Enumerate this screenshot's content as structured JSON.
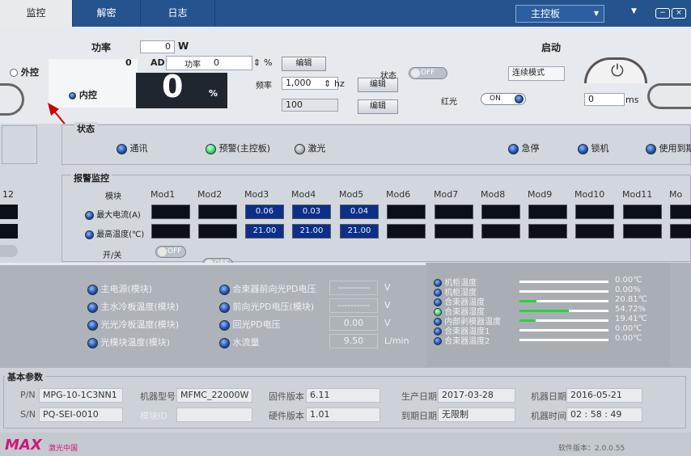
{
  "tabs": [
    "监控",
    "解密",
    "日志"
  ],
  "controller": "主控板",
  "top": {
    "power_label": "功率",
    "power_value": "0",
    "power_unit": "W",
    "start_label": "启动",
    "ext_label": "外控",
    "int_label": "内控",
    "ad_value": "0",
    "ad_label": "AD",
    "power2_label": "功率",
    "power2_value": "0",
    "pct": "%",
    "edit1": "编辑",
    "big_value": "0",
    "big_unit": "%",
    "freq_label": "频率",
    "freq_value": "1,000",
    "freq_unit": "hz",
    "edit2": "编辑",
    "duty_value": "100",
    "edit3": "编辑",
    "status_label": "状态",
    "off_label": "OFF",
    "red_label": "红光",
    "on_label": "ON",
    "mode_dd": "连续模式",
    "ms_value": "0",
    "ms_unit": "ms"
  },
  "status": {
    "title": "状态",
    "items": [
      "通讯",
      "预警(主控板)",
      "激光",
      "急停",
      "锁机",
      "使用到期"
    ]
  },
  "alarm": {
    "title": "报警监控",
    "col0": "模块",
    "left_edge": "12",
    "mods": [
      "Mod1",
      "Mod2",
      "Mod3",
      "Mod4",
      "Mod5",
      "Mod6",
      "Mod7",
      "Mod8",
      "Mod9",
      "Mod10",
      "Mod11",
      "Mo"
    ],
    "row1_label": "最大电流(A)",
    "row1": [
      "",
      "",
      "0.06",
      "0.03",
      "0.04",
      "",
      "",
      "",
      "",
      "",
      "",
      ""
    ],
    "row2_label": "最高温度(℃)",
    "row2": [
      "",
      "",
      "21.00",
      "21.00",
      "21.00",
      "",
      "",
      "",
      "",
      "",
      "",
      ""
    ],
    "row3_label": "开/关",
    "switches": [
      "OFF",
      "OFF",
      "ON",
      "ON",
      "ON",
      "OFF",
      "OFF",
      "OFF",
      "OFF",
      "OFF",
      "OFF",
      "OFF"
    ]
  },
  "sensors": {
    "left": [
      "主电源(模块)",
      "主水冷板温度(模块)",
      "光光冷板温度(模块)",
      "光模块温度(模块)"
    ],
    "mid": [
      {
        "label": "合束器前向光PD电压",
        "value": "----------",
        "unit": "V"
      },
      {
        "label": "前向光PD电压(模块)",
        "value": "----------",
        "unit": "V"
      },
      {
        "label": "回光PD电压",
        "value": "0.00",
        "unit": "V"
      },
      {
        "label": "水流量",
        "value": "9.50",
        "unit": "L/min"
      }
    ],
    "right": [
      {
        "label": "机柜温度",
        "value": "0.00℃",
        "fill": 0
      },
      {
        "label": "机柜湿度",
        "value": "0.00%",
        "fill": 0
      },
      {
        "label": "合束器温度",
        "value": "20.81℃",
        "fill": 0.19
      },
      {
        "label": "合束器湿度",
        "value": "54.72%",
        "fill": 0.55
      },
      {
        "label": "内部剥模器温度",
        "value": "19.41℃",
        "fill": 0.18
      },
      {
        "label": "合束器温度1",
        "value": "0.00℃",
        "fill": 0
      },
      {
        "label": "合束器温度2",
        "value": "0.00℃",
        "fill": 0
      }
    ]
  },
  "basic": {
    "title": "基本参数",
    "pn_label": "P/N",
    "pn": "MPG-10-1C3NN1",
    "model_label": "机器型号",
    "model": "MFMC_22000W",
    "fw_label": "固件版本",
    "fw": "6.11",
    "prod_label": "生产日期",
    "prod": "2017-03-28",
    "mdate_label": "机器日期",
    "mdate": "2016-05-21",
    "sn_label": "S/N",
    "sn": "PQ-SEI-0010",
    "mod_id_label": "模块ID",
    "mod_id": "",
    "hw_label": "硬件版本",
    "hw": "1.01",
    "exp_label": "到期日期",
    "exp": "无限制",
    "mtime_label": "机器时间",
    "mtime": "02 : 58 : 49"
  },
  "footer": {
    "logo": "MAX",
    "logo_sub": "激光中国",
    "version": "软件版本：2.0.0.55"
  },
  "colors": {
    "nav": "#24538e",
    "led_blue": "#1a4ea8",
    "switch_on": "#c02068"
  }
}
